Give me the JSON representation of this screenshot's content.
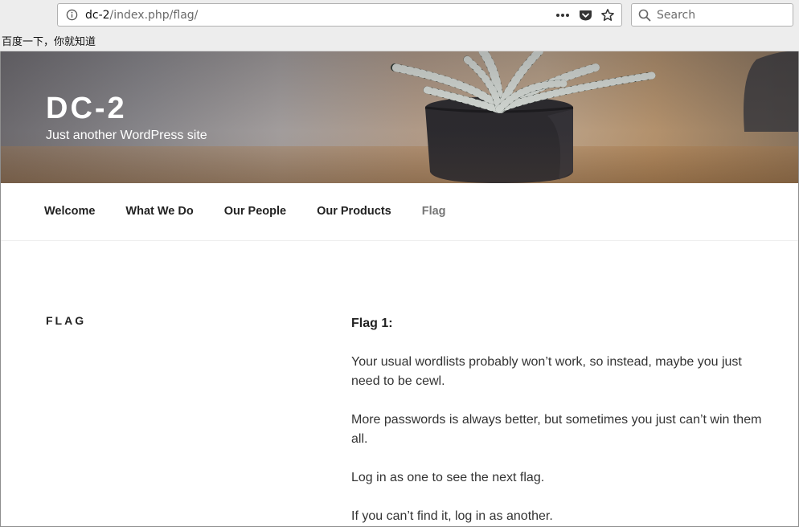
{
  "browser": {
    "url_host": "dc-2",
    "url_path": "/index.php/flag/",
    "search_placeholder": "Search",
    "bookmark_label": "百度一下，你就知道",
    "icons": [
      "info-icon",
      "more-icon",
      "pocket-icon",
      "bookmark-star-icon",
      "search-icon"
    ]
  },
  "site": {
    "title": "DC-2",
    "description": "Just another WordPress site"
  },
  "nav": {
    "items": [
      {
        "label": "Welcome"
      },
      {
        "label": "What We Do"
      },
      {
        "label": "Our People"
      },
      {
        "label": "Our Products"
      },
      {
        "label": "Flag"
      }
    ],
    "current": "Flag"
  },
  "page": {
    "title": "FLAG",
    "content": {
      "heading": "Flag 1:",
      "paragraphs": [
        "Your usual wordlists probably won’t work, so instead, maybe you just need to be cewl.",
        "More passwords is always better, but sometimes you just can’t win them all.",
        "Log in as one to see the next flag.",
        "If you can’t find it, log in as another."
      ]
    }
  },
  "colors": {
    "chrome_bg": "#ededed",
    "nav_current": "#767676",
    "text": "#333333"
  }
}
